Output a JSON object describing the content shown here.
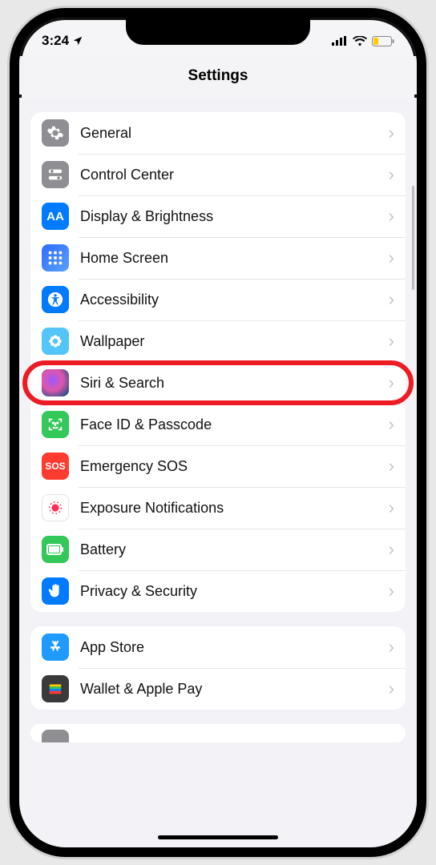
{
  "status": {
    "time": "3:24",
    "location_icon": "location-arrow",
    "signal": "signal-4",
    "wifi": "wifi",
    "battery": "battery-low-yellow"
  },
  "header": {
    "title": "Settings"
  },
  "groups": [
    {
      "items": [
        {
          "id": "general",
          "label": "General",
          "icon": "gear-icon",
          "bg": "bg-gray"
        },
        {
          "id": "control-center",
          "label": "Control Center",
          "icon": "switches-icon",
          "bg": "bg-gray"
        },
        {
          "id": "display-brightness",
          "label": "Display & Brightness",
          "icon": "aa-icon",
          "bg": "bg-blue"
        },
        {
          "id": "home-screen",
          "label": "Home Screen",
          "icon": "grid-icon",
          "bg": "bg-home"
        },
        {
          "id": "accessibility",
          "label": "Accessibility",
          "icon": "accessibility-icon",
          "bg": "bg-blue"
        },
        {
          "id": "wallpaper",
          "label": "Wallpaper",
          "icon": "flower-icon",
          "bg": "bg-cyan"
        },
        {
          "id": "siri-search",
          "label": "Siri & Search",
          "icon": "siri-icon",
          "bg": "bg-grad-siri",
          "highlighted": true
        },
        {
          "id": "face-id-passcode",
          "label": "Face ID & Passcode",
          "icon": "faceid-icon",
          "bg": "bg-green"
        },
        {
          "id": "emergency-sos",
          "label": "Emergency SOS",
          "icon": "sos-icon",
          "bg": "bg-red"
        },
        {
          "id": "exposure-notifications",
          "label": "Exposure Notifications",
          "icon": "exposure-icon",
          "bg": "bg-white-border"
        },
        {
          "id": "battery",
          "label": "Battery",
          "icon": "battery-icon",
          "bg": "bg-green"
        },
        {
          "id": "privacy-security",
          "label": "Privacy & Security",
          "icon": "hand-icon",
          "bg": "bg-blue"
        }
      ]
    },
    {
      "items": [
        {
          "id": "app-store",
          "label": "App Store",
          "icon": "appstore-icon",
          "bg": "bg-blue",
          "bgOverride": "#1f9bff"
        },
        {
          "id": "wallet-apple-pay",
          "label": "Wallet & Apple Pay",
          "icon": "wallet-icon",
          "bg": "bg-dark"
        }
      ]
    },
    {
      "items": [
        {
          "id": "passwords-cut",
          "label": "",
          "icon": "key-icon",
          "bg": "bg-gray"
        }
      ]
    }
  ],
  "icons": {
    "sos-text": "SOS",
    "aa-text": "AA"
  }
}
